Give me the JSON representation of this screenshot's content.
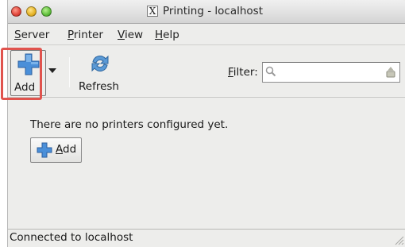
{
  "window": {
    "title": "Printing - localhost",
    "x_glyph": "X"
  },
  "menubar": {
    "items": [
      {
        "mnemonic": "S",
        "rest": "erver"
      },
      {
        "mnemonic": "P",
        "rest": "rinter"
      },
      {
        "mnemonic": "V",
        "rest": "iew"
      },
      {
        "mnemonic": "H",
        "rest": "elp"
      }
    ]
  },
  "toolbar": {
    "add_label": "Add",
    "refresh_label": "Refresh",
    "filter_mnemonic": "F",
    "filter_rest": "ilter:",
    "filter_value": ""
  },
  "content": {
    "message": "There are no printers configured yet.",
    "add_button_mnemonic": "A",
    "add_button_rest": "dd"
  },
  "statusbar": {
    "text": "Connected to localhost"
  },
  "icons": {
    "add": "plus-icon",
    "refresh": "refresh-icon",
    "search": "magnifier-icon",
    "clear": "clear-icon",
    "dropdown": "chevron-down-icon"
  },
  "colors": {
    "highlight": "#e0534d",
    "plus_blue": "#3f86d4"
  }
}
